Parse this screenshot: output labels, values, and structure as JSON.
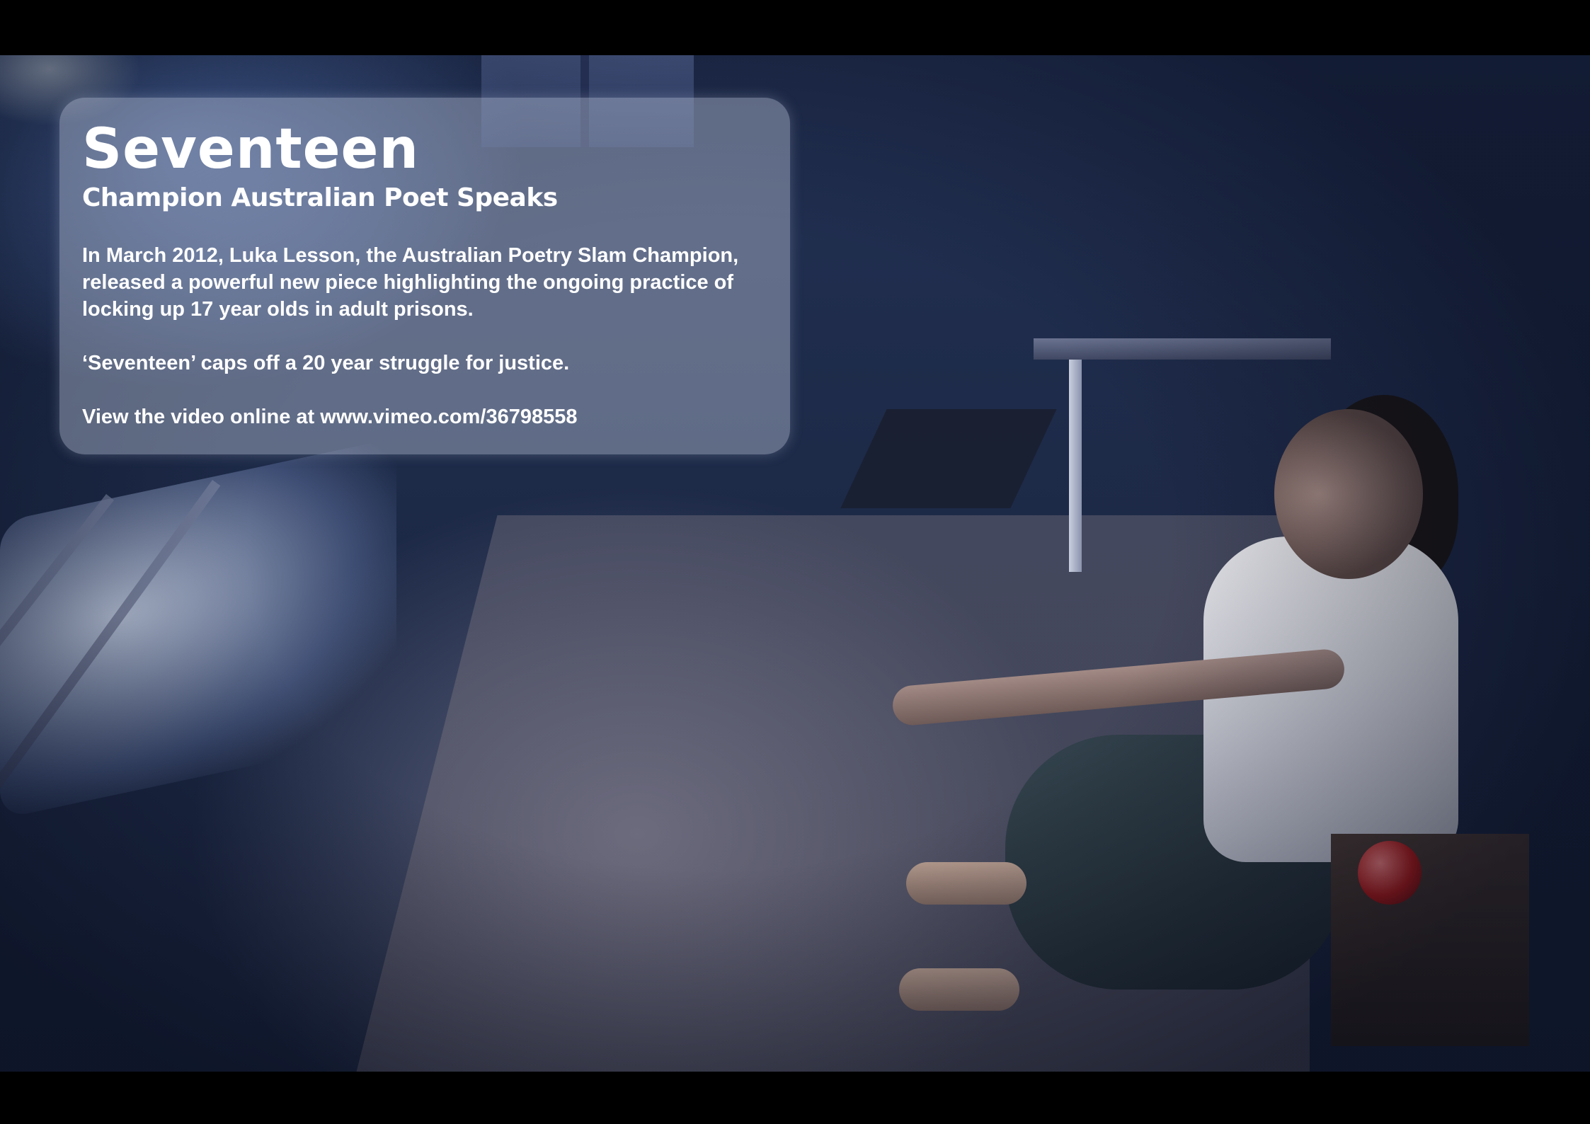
{
  "panel": {
    "title": "Seventeen",
    "subtitle": "Champion Australian Poet Speaks",
    "intro_lines": [
      "In March 2012, Luka Lesson, the Australian Poetry Slam Champion,",
      "released a powerful new piece highlighting the ongoing practice of",
      "locking  up 17 year olds in adult prisons."
    ],
    "tagline": "‘Seventeen’ caps off a 20 year struggle for justice.",
    "video_link": "View the video online at www.vimeo.com/36798558"
  },
  "scene": {
    "description_colors": {
      "ambient": "#1d2a48",
      "light": "#6e96e6",
      "panel": "#bec8de"
    }
  }
}
